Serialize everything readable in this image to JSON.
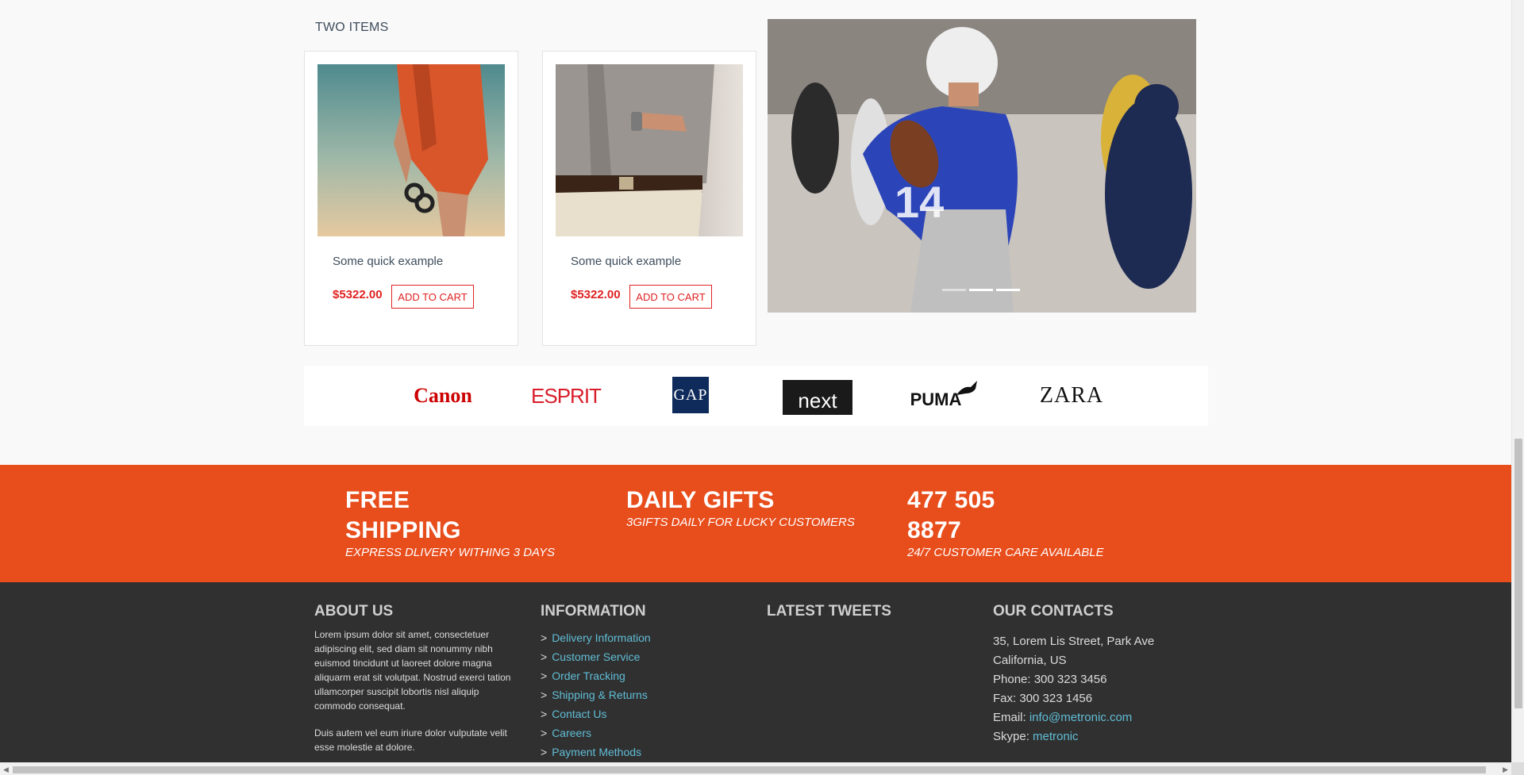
{
  "section": {
    "title": "TWO ITEMS"
  },
  "products": [
    {
      "name": "Some quick example",
      "price": "$5322.00",
      "cart_label": "ADD TO CART",
      "image": "orange-shorts-sunglasses"
    },
    {
      "name": "Some quick example",
      "price": "$5322.00",
      "cart_label": "ADD TO CART",
      "image": "man-shirt-watch"
    }
  ],
  "slider": {
    "image": "football-player",
    "slide_count": 3,
    "active_slide": 2
  },
  "brands": [
    {
      "name": "Canon",
      "color": "#cc0000"
    },
    {
      "name": "ESPRIT",
      "color": "#d81e2a"
    },
    {
      "name": "GAP",
      "color": "#0f2b5b"
    },
    {
      "name": "next",
      "color": "#1a1a1a"
    },
    {
      "name": "PUMA",
      "color": "#111111"
    },
    {
      "name": "ZARA",
      "color": "#111111"
    }
  ],
  "promo": {
    "bg_color": "#e84d1c",
    "blocks": [
      {
        "title_line1": "FREE",
        "title_line2": "SHIPPING",
        "subtitle": "EXPRESS DLIVERY WITHING 3 DAYS"
      },
      {
        "title_line1": "DAILY GIFTS",
        "title_line2": "",
        "subtitle": "3GIFTS DAILY FOR LUCKY CUSTOMERS"
      },
      {
        "title_line1": "477 505",
        "title_line2": "8877",
        "subtitle": "24/7 CUSTOMER CARE AVAILABLE"
      }
    ]
  },
  "footer": {
    "about": {
      "heading": "ABOUT US",
      "paragraph1": "Lorem ipsum dolor sit amet, consectetuer adipiscing elit, sed diam sit nonummy nibh euismod tincidunt ut laoreet dolore magna aliquarm erat sit volutpat. Nostrud exerci tation ullamcorper suscipit lobortis nisl aliquip commodo consequat.",
      "paragraph2": "Duis autem vel eum iriure dolor vulputate velit esse molestie at dolore."
    },
    "information": {
      "heading": "INFORMATION",
      "links": [
        "Delivery Information",
        "Customer Service",
        "Order Tracking",
        "Shipping & Returns",
        "Contact Us",
        "Careers",
        "Payment Methods"
      ]
    },
    "tweets": {
      "heading": "LATEST TWEETS"
    },
    "contacts": {
      "heading": "OUR CONTACTS",
      "address1": "35, Lorem Lis Street, Park Ave",
      "address2": "California, US",
      "phone": "Phone: 300 323 3456",
      "fax": "Fax: 300 323 1456",
      "email_label": "Email: ",
      "email": "info@metronic.com",
      "skype_label": "Skype: ",
      "skype": "metronic"
    },
    "link_color": "#5fbdd6"
  }
}
